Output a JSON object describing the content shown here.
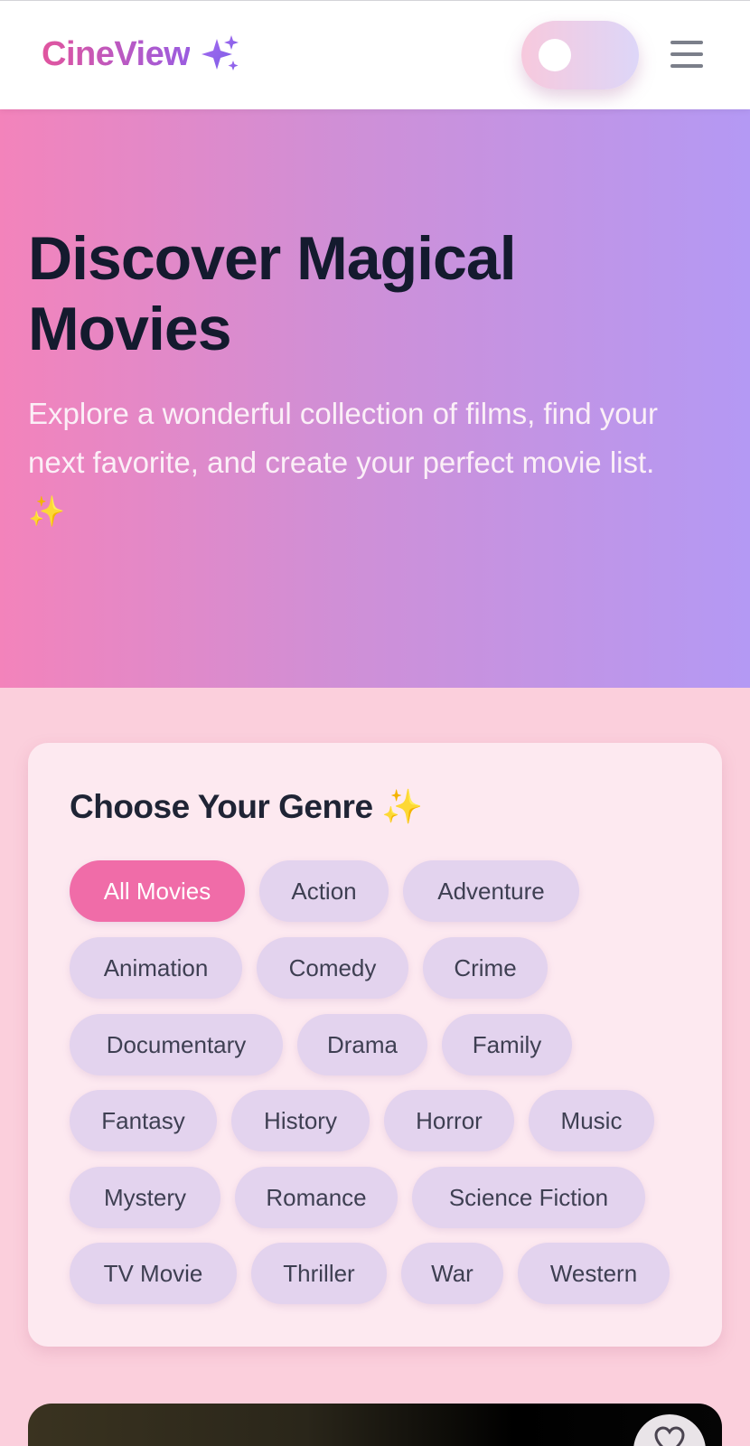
{
  "header": {
    "brand": "CineView",
    "brand_icon": "sparkles-icon",
    "theme_toggle_icon": "toggle-icon",
    "menu_icon": "hamburger-menu-icon"
  },
  "hero": {
    "title": "Discover Magical Movies",
    "description": "Explore a wonderful collection of films, find your next favorite, and create your perfect movie list. ✨"
  },
  "genres": {
    "title": "Choose Your Genre ✨",
    "active": "All Movies",
    "items": [
      "All Movies",
      "Action",
      "Adventure",
      "Animation",
      "Comedy",
      "Crime",
      "Documentary",
      "Drama",
      "Family",
      "Fantasy",
      "History",
      "Horror",
      "Music",
      "Mystery",
      "Romance",
      "Science Fiction",
      "TV Movie",
      "Thriller",
      "War",
      "Western"
    ]
  },
  "movie_card": {
    "favorite_icon": "heart-icon"
  },
  "colors": {
    "accent": "#f06ca8",
    "chip": "#e3d3ee",
    "page_bg": "#fbcfdc",
    "hero_start": "#f383bb",
    "hero_end": "#b499f4"
  }
}
